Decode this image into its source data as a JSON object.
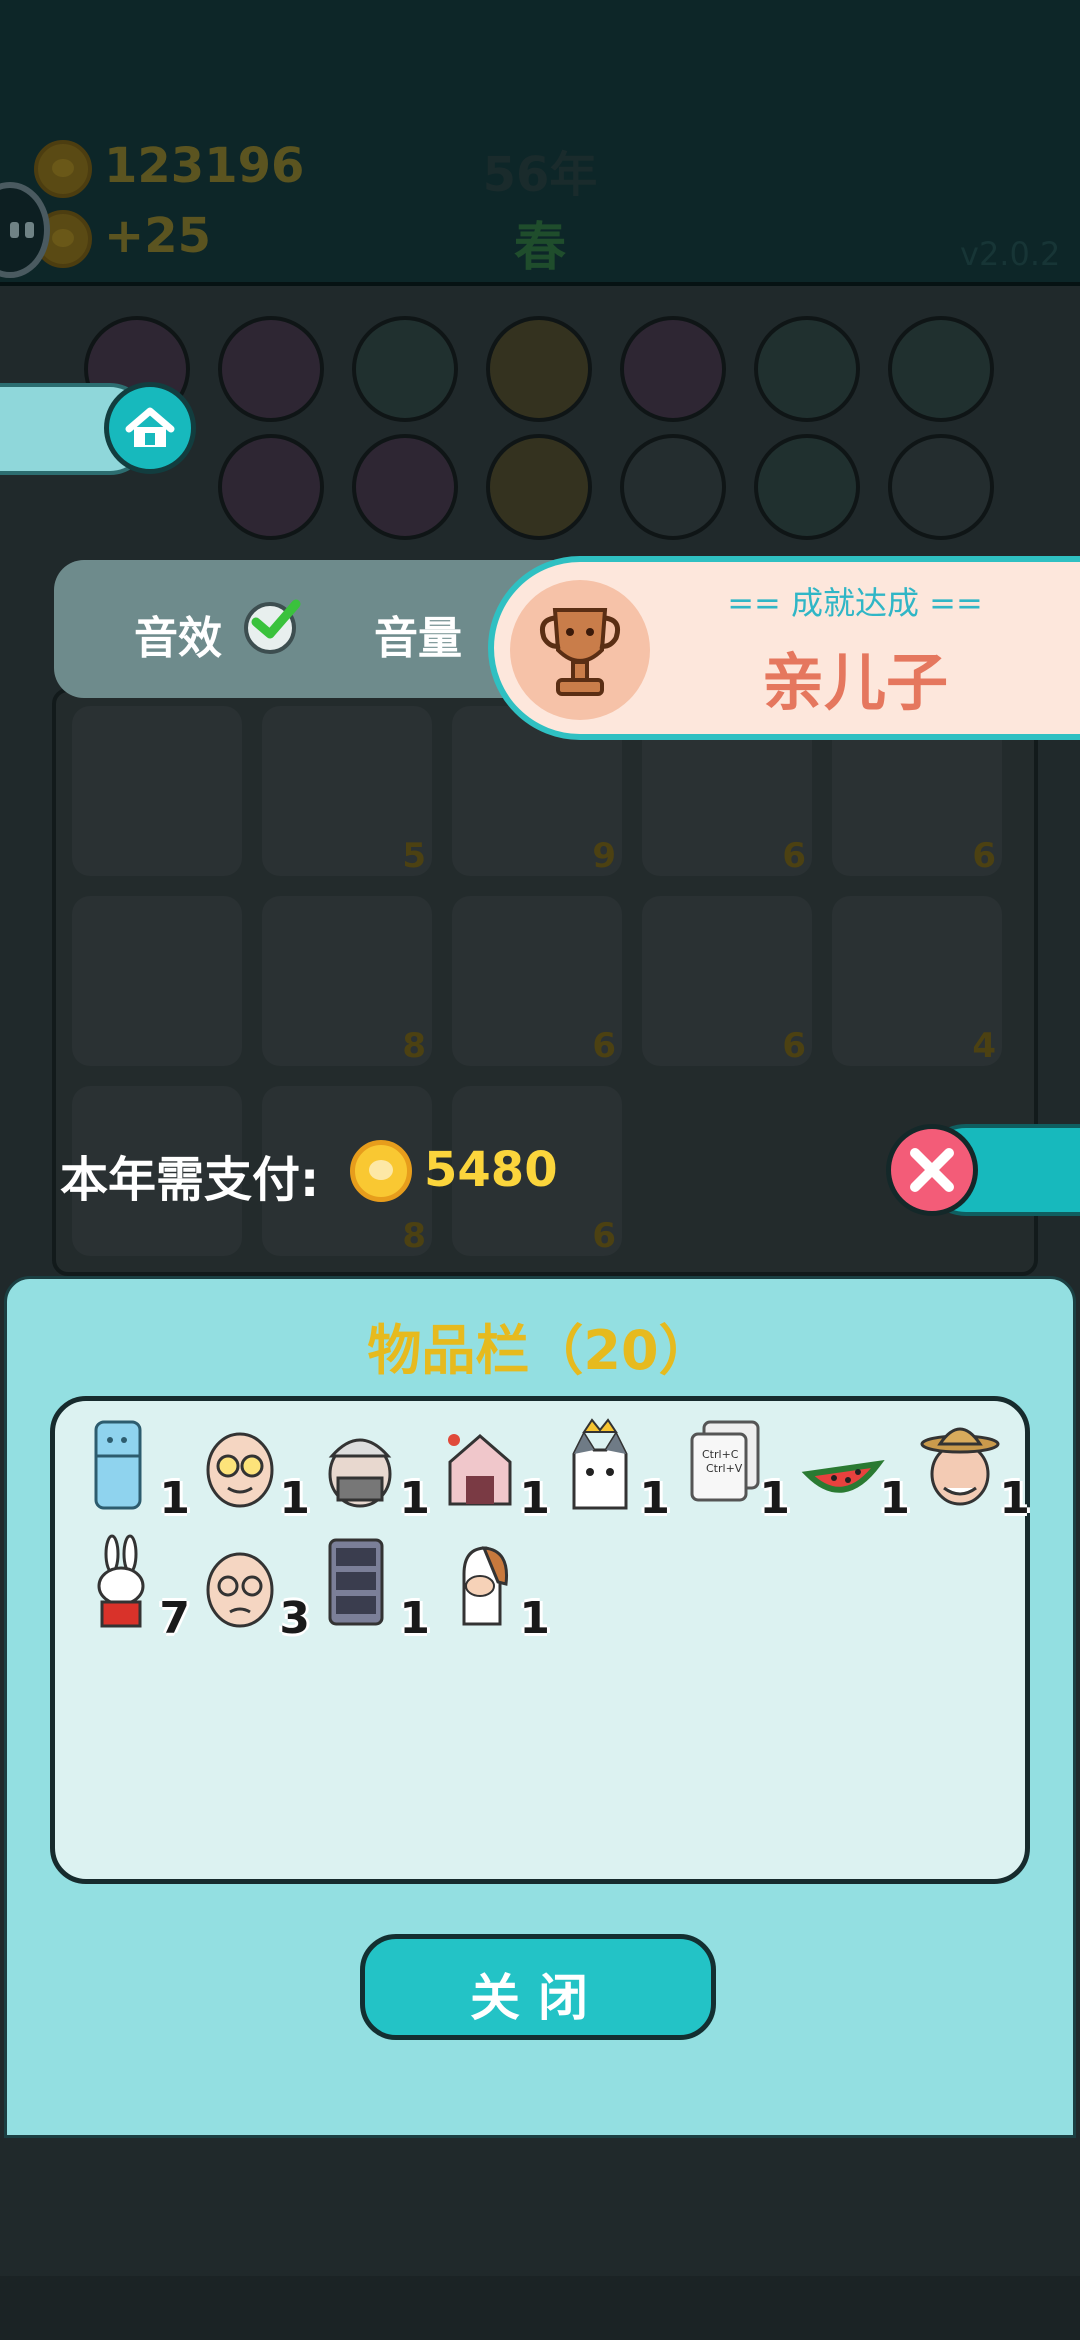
{
  "hud": {
    "coins": "123196",
    "income": "+25",
    "year": "56年",
    "season": "春",
    "version": "v2.0.2"
  },
  "board": {
    "cell_numbers": [
      "5",
      "9",
      "6",
      "6",
      "8",
      "6",
      "6",
      "4",
      "8",
      "6"
    ]
  },
  "settings": {
    "sound_effects_label": "音效",
    "volume_label": "音量"
  },
  "achievement": {
    "header": "== 成就达成 ==",
    "name": "亲儿子"
  },
  "payment": {
    "label": "本年需支付:",
    "amount": "5480"
  },
  "inventory": {
    "title": "物品栏（20）",
    "items": [
      {
        "icon": "refrigerator-icon",
        "count": "1"
      },
      {
        "icon": "bald-grandpa-yellow-glasses-icon",
        "count": "1"
      },
      {
        "icon": "old-man-cap-icon",
        "count": "1"
      },
      {
        "icon": "rabbit-house-icon",
        "count": "1"
      },
      {
        "icon": "husky-king-icon",
        "count": "1"
      },
      {
        "icon": "ctrl-c-ctrl-v-paper-icon",
        "count": "1"
      },
      {
        "icon": "watermelon-icon",
        "count": "1"
      },
      {
        "icon": "farmer-grandpa-icon",
        "count": "1"
      },
      {
        "icon": "rabbit-icon",
        "count": "7"
      },
      {
        "icon": "bald-grandpa-glasses-icon",
        "count": "3"
      },
      {
        "icon": "server-rack-icon",
        "count": "1"
      },
      {
        "icon": "horse-icon",
        "count": "1"
      }
    ],
    "close_label": "关闭"
  },
  "colors": {
    "panel": "#93dfe1",
    "accent": "#23c3c6",
    "title": "#e6ba1e",
    "coin": "#f9c832",
    "achievement_text": "#e5775e"
  }
}
